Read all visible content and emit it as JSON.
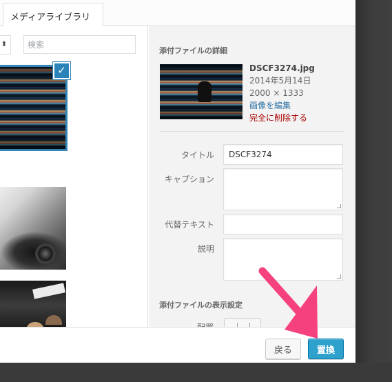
{
  "tabs": {
    "media_library": "メディアライブラリ"
  },
  "filter": {
    "icon": "updown-arrows-icon",
    "symbol": "⬍"
  },
  "search": {
    "placeholder": "検索"
  },
  "grid": {
    "selected_check": "✓"
  },
  "details": {
    "section_title": "添付ファイルの詳細",
    "filename": "DSCF3274.jpg",
    "date": "2014年5月14日",
    "dimensions": "2000 × 1333",
    "edit_link": "画像を編集",
    "delete_link": "完全に削除する"
  },
  "fields": {
    "title_label": "タイトル",
    "title_value": "DSCF3274",
    "caption_label": "キャプション",
    "alt_label": "代替テキスト",
    "description_label": "説明"
  },
  "display_settings": {
    "section_title": "添付ファイルの表示設定",
    "align_label": "配置"
  },
  "toolbar": {
    "back_label": "戻る",
    "replace_label": "置換"
  },
  "colors": {
    "accent": "#2ea2cc",
    "arrow": "#f5417d",
    "delete": "#aa0000",
    "link": "#2e72a5"
  }
}
